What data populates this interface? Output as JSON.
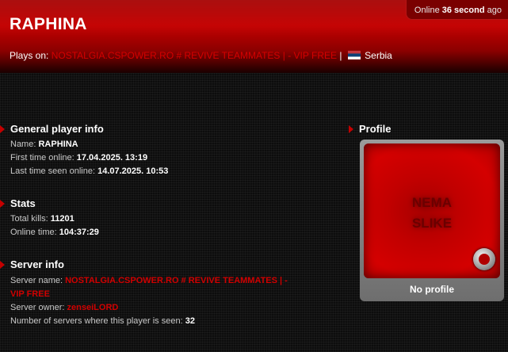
{
  "header": {
    "online_prefix": "Online",
    "online_value": "36 second",
    "online_suffix": "ago",
    "player_name": "RAPHINA",
    "plays_on_label": "Plays on:",
    "server_link": "NOSTALGIA.CSPOWER.RO # REVIVE TEAMMATES | - VIP FREE",
    "separator": "|",
    "country": "Serbia",
    "flag_icon": "serbia-flag-icon"
  },
  "general": {
    "title": "General player info",
    "name_label": "Name:",
    "name_value": "RAPHINA",
    "first_label": "First time online:",
    "first_value": "17.04.2025. 13:19",
    "last_label": "Last time seen online:",
    "last_value": "14.07.2025. 10:53"
  },
  "stats": {
    "title": "Stats",
    "kills_label": "Total kills:",
    "kills_value": "11201",
    "time_label": "Online time:",
    "time_value": "104:37:29"
  },
  "server": {
    "title": "Server info",
    "name_label": "Server name:",
    "name_value_line1": "NOSTALGIA.CSPOWER.RO # REVIVE TEAMMATES | -",
    "name_value_line2": "VIP FREE",
    "owner_label": "Server owner:",
    "owner_value": "zenseiLORD",
    "count_label": "Number of servers where this player is seen:",
    "count_value": "32"
  },
  "profile": {
    "title": "Profile",
    "image_text_line1": "NEMA",
    "image_text_line2": "SLIKE",
    "caption": "No profile"
  },
  "colors": {
    "accent": "#c40000",
    "link_red": "#d00000",
    "background": "#0d0d0d"
  }
}
